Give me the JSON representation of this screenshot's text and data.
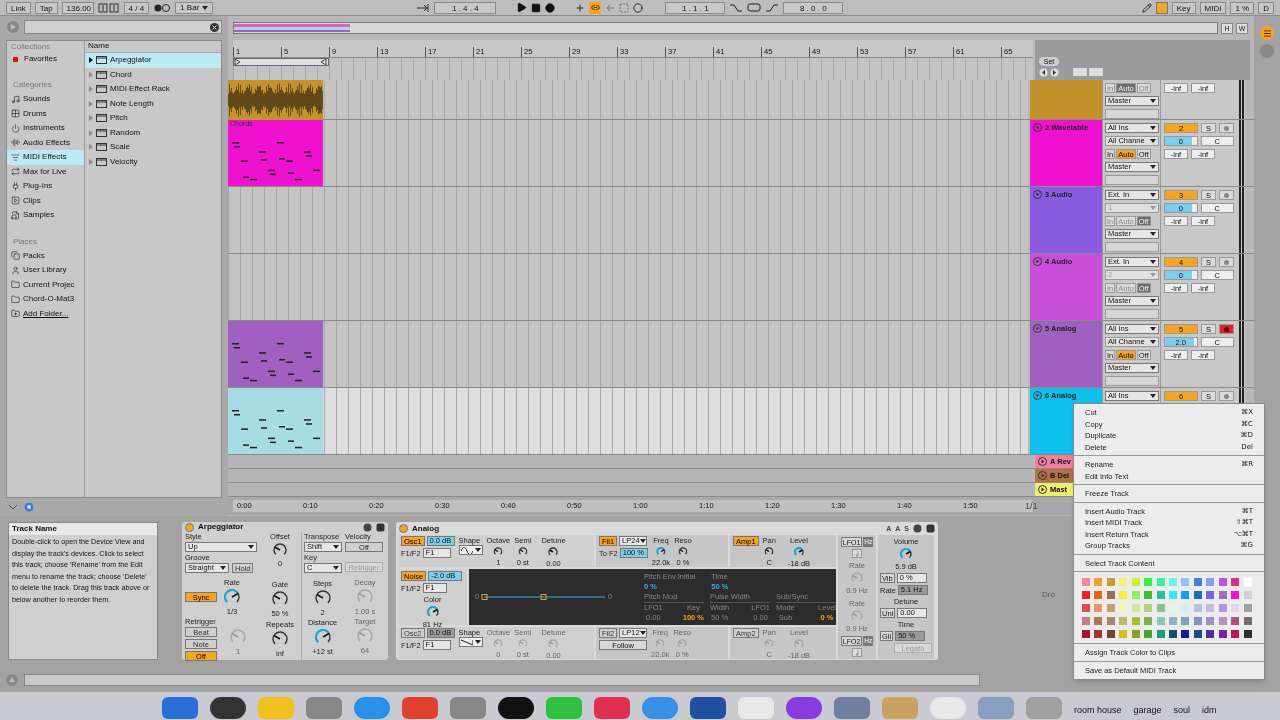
{
  "transport": {
    "link": "Link",
    "tap": "Tap",
    "tempo": "136.00",
    "signature": "4 / 4",
    "quantize": "1 Bar",
    "position": "1 . 4 . 4",
    "loop_start": "1 . 1 . 1",
    "loop_length": "8 . 0 . 0",
    "key": "Key",
    "midi": "MIDI",
    "cpu": "1 %",
    "d": "D"
  },
  "browser": {
    "collections_heading": "Collections",
    "collections": [
      {
        "label": "Favorites",
        "color": "#e01010"
      }
    ],
    "categories_heading": "Categories",
    "categories": [
      {
        "label": "Sounds",
        "selected": false
      },
      {
        "label": "Drums",
        "selected": false
      },
      {
        "label": "Instruments",
        "selected": false
      },
      {
        "label": "Audio Effects",
        "selected": false
      },
      {
        "label": "MIDI Effects",
        "selected": true
      },
      {
        "label": "Max for Live",
        "selected": false
      },
      {
        "label": "Plug-Ins",
        "selected": false
      },
      {
        "label": "Clips",
        "selected": false
      },
      {
        "label": "Samples",
        "selected": false
      }
    ],
    "places_heading": "Places",
    "places": [
      "Packs",
      "User Library",
      "Current Projec",
      "Chord-O-Mat3",
      "Add Folder..."
    ],
    "name_heading": "Name",
    "items": [
      {
        "label": "Arpeggiator",
        "selected": true
      },
      {
        "label": "Chord",
        "selected": false
      },
      {
        "label": "MIDI Effect Rack",
        "selected": false
      },
      {
        "label": "Note Length",
        "selected": false
      },
      {
        "label": "Pitch",
        "selected": false
      },
      {
        "label": "Random",
        "selected": false
      },
      {
        "label": "Scale",
        "selected": false
      },
      {
        "label": "Velocity",
        "selected": false
      }
    ]
  },
  "arrangement": {
    "overview_buttons": [
      "H",
      "W"
    ],
    "set": "Set",
    "bar_numbers": [
      "1",
      "5",
      "9",
      "13",
      "17",
      "21",
      "25",
      "29",
      "33",
      "37",
      "41",
      "45",
      "49",
      "53",
      "57",
      "61",
      "65"
    ],
    "tracks": [
      {
        "color": "#c4922a",
        "selected": false,
        "clip": {
          "kind": "audio",
          "color": "#c4922a"
        },
        "monitor": [
          {
            "label": "In",
            "selected": false
          },
          {
            "label": "Auto",
            "selected": true
          },
          {
            "label": "Off",
            "selected": false
          }
        ],
        "monitor_disabled": true,
        "output": "Master",
        "sends": [
          "-inf",
          "-inf"
        ]
      },
      {
        "name": "2 Wavetable",
        "color": "#f010d0",
        "selected": false,
        "clip": {
          "kind": "midi",
          "color": "#f010d0",
          "label": "Chords"
        },
        "input": "All Ins",
        "channel": "All Channe",
        "channel_disabled": false,
        "monitor": [
          {
            "label": "In",
            "selected": false
          },
          {
            "label": "Auto",
            "selected": true
          },
          {
            "label": "Off",
            "selected": false
          }
        ],
        "monitor_disabled": false,
        "output": "Master",
        "number": "2",
        "solo": "S",
        "armed": false,
        "volume": {
          "value": "0",
          "level": 0.85
        },
        "pan": "C",
        "sends": [
          "-inf",
          "-inf"
        ]
      },
      {
        "name": "3 Audio",
        "color": "#8a5ae0",
        "selected": false,
        "input": "Ext. In",
        "channel": "1",
        "channel_disabled": true,
        "monitor": [
          {
            "label": "In",
            "selected": false
          },
          {
            "label": "Auto",
            "selected": false
          },
          {
            "label": "Off",
            "selected": true
          }
        ],
        "monitor_disabled": true,
        "output": "Master",
        "number": "3",
        "solo": "S",
        "armed": false,
        "volume": {
          "value": "0",
          "level": 0.85
        },
        "pan": "C",
        "sends": [
          "-inf",
          "-inf"
        ]
      },
      {
        "name": "4 Audio",
        "color": "#c850d8",
        "selected": false,
        "input": "Ext. In",
        "channel": "2",
        "channel_disabled": true,
        "monitor": [
          {
            "label": "In",
            "selected": false
          },
          {
            "label": "Auto",
            "selected": false
          },
          {
            "label": "Off",
            "selected": true
          }
        ],
        "monitor_disabled": true,
        "output": "Master",
        "number": "4",
        "solo": "S",
        "armed": false,
        "volume": {
          "value": "0",
          "level": 0.85
        },
        "pan": "C",
        "sends": [
          "-inf",
          "-inf"
        ]
      },
      {
        "name": "5 Analog",
        "color": "#a060c0",
        "selected": false,
        "clip": {
          "kind": "midi",
          "color": "#a060c0"
        },
        "input": "All Ins",
        "channel": "All Channe",
        "channel_disabled": false,
        "monitor": [
          {
            "label": "In",
            "selected": false
          },
          {
            "label": "Auto",
            "selected": true
          },
          {
            "label": "Off",
            "selected": false
          }
        ],
        "monitor_disabled": false,
        "output": "Master",
        "number": "5",
        "solo": "S",
        "armed": true,
        "volume": {
          "value": "2.0",
          "level": 0.92
        },
        "pan": "C",
        "sends": [
          "-inf",
          "-inf"
        ]
      },
      {
        "name": "6 Analog",
        "color": "#10c0ec",
        "selected": true,
        "clip": {
          "kind": "midi",
          "color": "#a8dce4"
        },
        "input": "All Ins",
        "number": "6",
        "solo": "S",
        "armed": false
      }
    ],
    "returns": [
      {
        "name": "A Rev",
        "color": "#f080a0"
      },
      {
        "name": "B Del",
        "color": "#b07048"
      },
      {
        "name": "Mast",
        "color": "#f0f070"
      }
    ],
    "time_marks": [
      "0:00",
      "0:10",
      "0:20",
      "0:30",
      "0:40",
      "0:50",
      "1:00",
      "1:10",
      "1:20",
      "1:30",
      "1:40",
      "1:50"
    ],
    "zoom": "1/1"
  },
  "context_menu": {
    "sections": [
      {
        "kind": "items",
        "items": [
          {
            "label": "Cut",
            "shortcut": "⌘X"
          },
          {
            "label": "Copy",
            "shortcut": "⌘C"
          },
          {
            "label": "Duplicate",
            "shortcut": "⌘D"
          },
          {
            "label": "Delete",
            "shortcut": "Del"
          }
        ]
      },
      {
        "kind": "items",
        "items": [
          {
            "label": "Rename",
            "shortcut": "⌘R"
          },
          {
            "label": "Edit Info Text"
          }
        ]
      },
      {
        "kind": "items",
        "items": [
          {
            "label": "Freeze Track"
          }
        ]
      },
      {
        "kind": "items",
        "items": [
          {
            "label": "Insert Audio Track",
            "shortcut": "⌘T"
          },
          {
            "label": "Insert MIDI Track",
            "shortcut": "⇧⌘T"
          },
          {
            "label": "Insert Return Track",
            "shortcut": "⌥⌘T"
          },
          {
            "label": "Group Tracks",
            "shortcut": "⌘G"
          }
        ]
      },
      {
        "kind": "items",
        "items": [
          {
            "label": "Select Track Content"
          }
        ]
      },
      {
        "kind": "swatches",
        "swatches": [
          {
            "color": "#ee8a9a"
          },
          {
            "color": "#f5a030"
          },
          {
            "color": "#c79a3a"
          },
          {
            "color": "#f5f07a"
          },
          {
            "color": "#c8f52a"
          },
          {
            "color": "#30f040"
          },
          {
            "color": "#3af0a8"
          },
          {
            "color": "#6af5e0"
          },
          {
            "color": "#90c4f5"
          },
          {
            "color": "#4a7ad8"
          },
          {
            "color": "#8a9cf5"
          },
          {
            "color": "#c050e0"
          },
          {
            "color": "#d83090"
          },
          {
            "color": "#ffffff"
          },
          {
            "color": "#ee2020"
          },
          {
            "color": "#f06010"
          },
          {
            "color": "#9a7050"
          },
          {
            "color": "#f8f030"
          },
          {
            "color": "#90f060"
          },
          {
            "color": "#40c030"
          },
          {
            "color": "#20c0a0"
          },
          {
            "color": "#30e8f8"
          },
          {
            "color": "#18a0e8"
          },
          {
            "color": "#1870b0"
          },
          {
            "color": "#8060e0"
          },
          {
            "color": "#a070c0"
          },
          {
            "color": "#f010d0"
          },
          {
            "color": "#d0d0d0"
          },
          {
            "color": "#d85050"
          },
          {
            "color": "#f09070"
          },
          {
            "color": "#c8a070"
          },
          {
            "color": "#f0f8b0"
          },
          {
            "color": "#d0e8a0"
          },
          {
            "color": "#b0d080"
          },
          {
            "color": "#90c090"
          },
          {
            "color": "#e0f8e8"
          },
          {
            "color": "#d0eef5"
          },
          {
            "color": "#b8c0e0"
          },
          {
            "color": "#c8b8e8"
          },
          {
            "color": "#a898e0"
          },
          {
            "color": "#e0d8e8"
          },
          {
            "color": "#a0a0a0"
          },
          {
            "color": "#c08080"
          },
          {
            "color": "#b07850"
          },
          {
            "color": "#a08870"
          },
          {
            "color": "#c0b870"
          },
          {
            "color": "#a8c020"
          },
          {
            "color": "#80b050"
          },
          {
            "color": "#88c8b8"
          },
          {
            "color": "#98b0c8"
          },
          {
            "color": "#80a0c0"
          },
          {
            "color": "#8890c8"
          },
          {
            "color": "#a090c0"
          },
          {
            "color": "#b890c0"
          },
          {
            "color": "#b05080"
          },
          {
            "color": "#707070"
          },
          {
            "color": "#a01830"
          },
          {
            "color": "#a03828"
          },
          {
            "color": "#704838"
          },
          {
            "color": "#d8c010"
          },
          {
            "color": "#88a020"
          },
          {
            "color": "#50a030"
          },
          {
            "color": "#18a080"
          },
          {
            "color": "#185070"
          },
          {
            "color": "#102090"
          },
          {
            "color": "#204890"
          },
          {
            "color": "#5030a0"
          },
          {
            "color": "#8020a0"
          },
          {
            "color": "#c01060"
          },
          {
            "color": "#303030"
          }
        ]
      },
      {
        "kind": "items",
        "items": [
          {
            "label": "Assign Track Color to Clips"
          }
        ]
      },
      {
        "kind": "items",
        "items": [
          {
            "label": "Save as Default MIDI Track"
          }
        ]
      }
    ]
  },
  "info": {
    "title": "Track Name",
    "text": "Double-click to open the Device View and display the track's devices. Click to select this track; choose 'Rename' from the Edit menu to rename the track; choose 'Delete' to delete the track. Drag this track above or below another to reorder them."
  },
  "arpeggiator": {
    "name": "Arpeggiator",
    "on": true,
    "style_label": "Style",
    "style": "Up",
    "groove_label": "Groove",
    "groove": "Straight",
    "hold": {
      "label": "Hold",
      "on": false
    },
    "sync": {
      "label": "Sync",
      "on": true
    },
    "rate": {
      "label": "Rate",
      "value": "1/3",
      "active": true
    },
    "retrigger_label": "Retrigger",
    "retrigger_modes": [
      {
        "label": "Beat",
        "selected": false
      },
      {
        "label": "Note",
        "selected": false
      },
      {
        "label": "Off",
        "selected": true
      }
    ],
    "retrigger_knob": {
      "value": "1",
      "active": false,
      "disabled": true
    },
    "offset": {
      "label": "Offset",
      "value": "0",
      "active": false
    },
    "gate": {
      "label": "Gate",
      "value": "50 %",
      "active": false
    },
    "repeats": {
      "label": "Repeats",
      "value": "inf",
      "active": false
    },
    "transpose_label": "Transpose",
    "transpose": "Shift",
    "key_label": "Key",
    "key": "C",
    "steps": {
      "label": "Steps",
      "value": "2",
      "active": false
    },
    "distance": {
      "label": "Distance",
      "value": "+12 st",
      "active": true
    },
    "velocity_label": "Velocity",
    "velocity": {
      "label": "Off",
      "on": false
    },
    "velocity_retrigger": "Retrigger",
    "decay": {
      "label": "Decay",
      "value": "1.00 s",
      "active": false,
      "disabled": true
    },
    "target": {
      "label": "Target",
      "value": "64",
      "active": false,
      "disabled": true
    }
  },
  "analog": {
    "name": "Analog",
    "on": true,
    "header_buttons": [
      "A",
      "A",
      "S"
    ],
    "osc1": {
      "button": "Osc1",
      "on": true,
      "gain": "0.0 dB",
      "f_label": "F1/F2",
      "f": "F1",
      "shape_label": "Shape",
      "octave": {
        "label": "Octave",
        "value": "1",
        "active": false
      },
      "semi": {
        "label": "Semi",
        "value": "0 st",
        "active": false
      },
      "detune": {
        "label": "Detune",
        "value": "0.00",
        "active": false
      }
    },
    "noise": {
      "button": "Noise",
      "on": true,
      "gain": "-2.0 dB",
      "f_label": "F1/F2",
      "f": "F1",
      "color": {
        "label": "Color",
        "value": "81 Hz",
        "active": true
      }
    },
    "osc2": {
      "button": "Osc2",
      "on": false,
      "gain": "0.0 dB",
      "f_label": "F1/F2",
      "f": "F1",
      "shape_label": "Shape",
      "octave": {
        "label": "Octave",
        "value": "0",
        "active": false,
        "disabled": true
      },
      "semi": {
        "label": "Semi",
        "value": "0 st",
        "active": false,
        "disabled": true
      },
      "detune": {
        "label": "Detune",
        "value": "0.00",
        "active": false,
        "disabled": true
      }
    },
    "fil1": {
      "button": "Fil1",
      "on": true,
      "type": "LP24",
      "to_label": "To F2",
      "to": "100 %",
      "freq": {
        "label": "Freq",
        "value": "22.0k",
        "active": true
      },
      "reso": {
        "label": "Reso",
        "value": "0 %",
        "active": false
      }
    },
    "fil2": {
      "button": "Fil2",
      "on": false,
      "type": "LP12",
      "follow": "Follow",
      "freq": {
        "label": "Freq",
        "value": "22.0k",
        "active": false,
        "disabled": true
      },
      "reso": {
        "label": "Reso",
        "value": "0 %",
        "active": false,
        "disabled": true
      }
    },
    "amp1": {
      "button": "Amp1",
      "on": true,
      "pan": {
        "label": "Pan",
        "value": "C",
        "active": false
      },
      "level": {
        "label": "Level",
        "value": "-18 dB",
        "active": true
      }
    },
    "amp2": {
      "button": "Amp2",
      "on": false,
      "pan": {
        "label": "Pan",
        "value": "C",
        "active": false,
        "disabled": true
      },
      "level": {
        "label": "Level",
        "value": "-18 dB",
        "active": false,
        "disabled": true
      }
    },
    "lfo1": {
      "button": "LFO1",
      "hz": "Hz",
      "rate": {
        "label": "Rate",
        "value": "0.9 Hz",
        "active": false,
        "disabled": true
      }
    },
    "lfo2": {
      "button": "LFO2",
      "hz": "Hz",
      "rate": {
        "label": "Rate",
        "value": "0.9 Hz",
        "active": false,
        "disabled": true
      }
    },
    "display": {
      "env": [
        {
          "label": "Pitch Env Initial",
          "value": "0 %"
        },
        {
          "label": "Time",
          "value": "50 %"
        }
      ],
      "scale": [
        "0",
        "0"
      ],
      "groups": [
        {
          "label": "Pitch Mod",
          "cols": [
            {
              "label": "LFO1",
              "value": "0.00",
              "active": false
            },
            {
              "label": "Key",
              "value": "100 %",
              "active": true
            }
          ]
        },
        {
          "label": "Pulse Width",
          "cols": [
            {
              "label": "Width",
              "value": "50 %",
              "active": false
            },
            {
              "label": "LFO1",
              "value": "0.00",
              "active": false
            }
          ]
        },
        {
          "label": "Sub/Sync",
          "cols": [
            {
              "label": "Mode",
              "value": "Sub",
              "active": false
            },
            {
              "label": "Level",
              "value": "0 %",
              "active": true
            }
          ]
        }
      ]
    },
    "global": {
      "volume": {
        "label": "Volume",
        "value": "5.9 dB",
        "active": true
      },
      "vib": "Vib",
      "vib_value": "0 %",
      "rate_label": "Rate",
      "rate_value": "5.1 Hz",
      "detune_label": "Detune",
      "uni": "Uni",
      "detune_value": "0.00",
      "time_label": "Time",
      "gli": "Gli",
      "time_value": "50 %",
      "legato": "Legato"
    }
  },
  "drop_hint": "Dro",
  "dock": {
    "labels": [
      "room house",
      "garage",
      "soul",
      "idm"
    ]
  }
}
